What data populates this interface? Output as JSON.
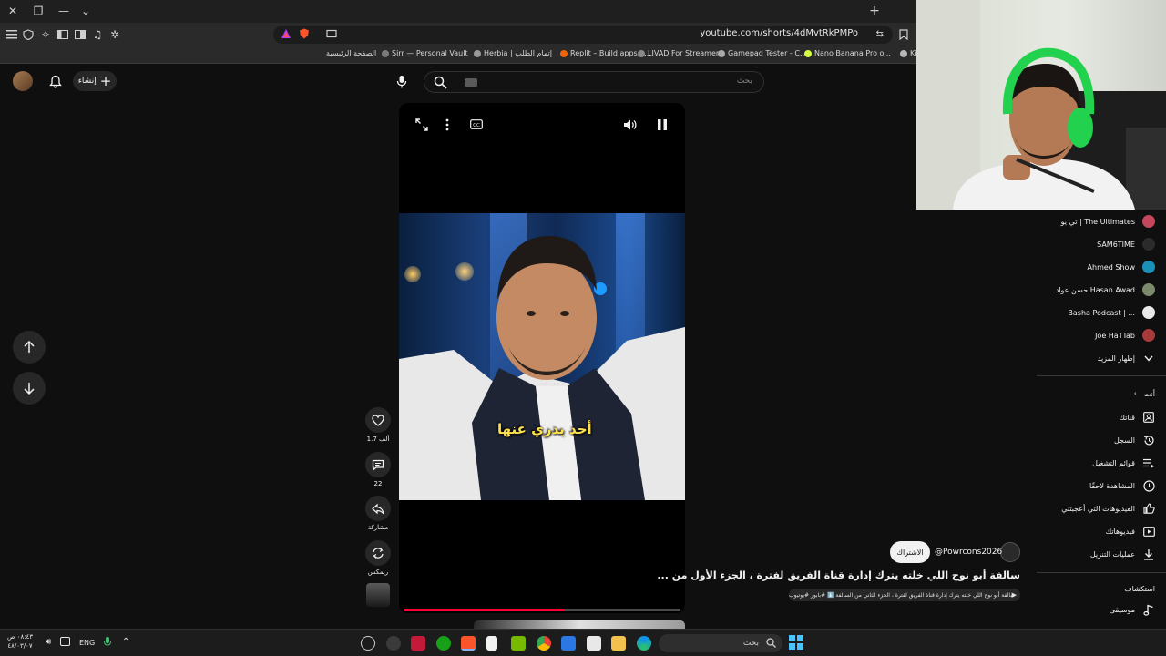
{
  "browser": {
    "url": "youtube.com/shorts/4dMvtRkPMPo",
    "bookmarks": [
      {
        "label": "الصفحة الرئيسية",
        "color": "#e8e8e8"
      },
      {
        "label": "Sirr — Personal Vault",
        "color": "#7a7a7a"
      },
      {
        "label": "Herbia | إتمام الطلب",
        "color": "#9a9a9a"
      },
      {
        "label": "Replit – Build apps a...",
        "color": "#f26207"
      },
      {
        "label": "LIVAD For Streamer...",
        "color": "#8a8a8a"
      },
      {
        "label": "Gamepad Tester - C...",
        "color": "#aaaaaa"
      },
      {
        "label": "Nano Banana Pro o...",
        "color": "#d4ff3c"
      },
      {
        "label": "Ki",
        "color": "#b8b8b8"
      }
    ]
  },
  "header": {
    "create_label": "إنشاء",
    "search_placeholder": "بحث"
  },
  "player": {
    "caption": "أحد يدري عنها",
    "progress_fraction": 0.58
  },
  "actions": {
    "likes": "1.7 ألف",
    "comments": "22",
    "share": "مشاركة",
    "remix": "ريمكس"
  },
  "video": {
    "channel": "@Powrcons2026",
    "subscribe": "الاشتراك",
    "title": "سالفة أبو نوح اللي خلته يترك إدارة قناة الفريق لفترة ، الجزء الأول من ...",
    "subtitle": "سالفة أبو نوح اللي خلته يترك إدارة قناة الفريق لفترة ، الجزء الثاني من السالفة ⬇️ #بابور #يوتيوب"
  },
  "sidebar": {
    "subscriptions": [
      {
        "label": "تي يو | The Ultimates",
        "color": "#c4475c"
      },
      {
        "label": "SAM6TIME",
        "color": "#2b2b2b"
      },
      {
        "label": "Ahmed Show",
        "color": "#1a8fb8"
      },
      {
        "label": "حسن عواد Hasan Awad",
        "color": "#7a8a6a"
      },
      {
        "label": "Basha Podcast | ...",
        "color": "#e9e9e9"
      },
      {
        "label": "Joe HaTTab",
        "color": "#a83a3a"
      }
    ],
    "show_more": "إظهار المزيد",
    "you_header": "أنت",
    "you_items": [
      {
        "label": "قناتك",
        "icon": "account-box-icon"
      },
      {
        "label": "السجل",
        "icon": "history-icon"
      },
      {
        "label": "قوائم التشغيل",
        "icon": "playlists-icon"
      },
      {
        "label": "المشاهدة لاحقًا",
        "icon": "watch-later-icon"
      },
      {
        "label": "الفيديوهات التي أعجبتني",
        "icon": "liked-icon"
      },
      {
        "label": "فيديوهاتك",
        "icon": "your-videos-icon"
      },
      {
        "label": "عمليات التنزيل",
        "icon": "download-icon"
      }
    ],
    "explore_header": "استكشاف",
    "explore_items": [
      {
        "label": "موسيقى",
        "icon": "music-icon"
      }
    ]
  },
  "taskbar": {
    "time": "٠٨:٤٣ ص",
    "date": "٤٨/٠٣/٠٧",
    "lang": "ENG",
    "search_placeholder": "بحث"
  }
}
